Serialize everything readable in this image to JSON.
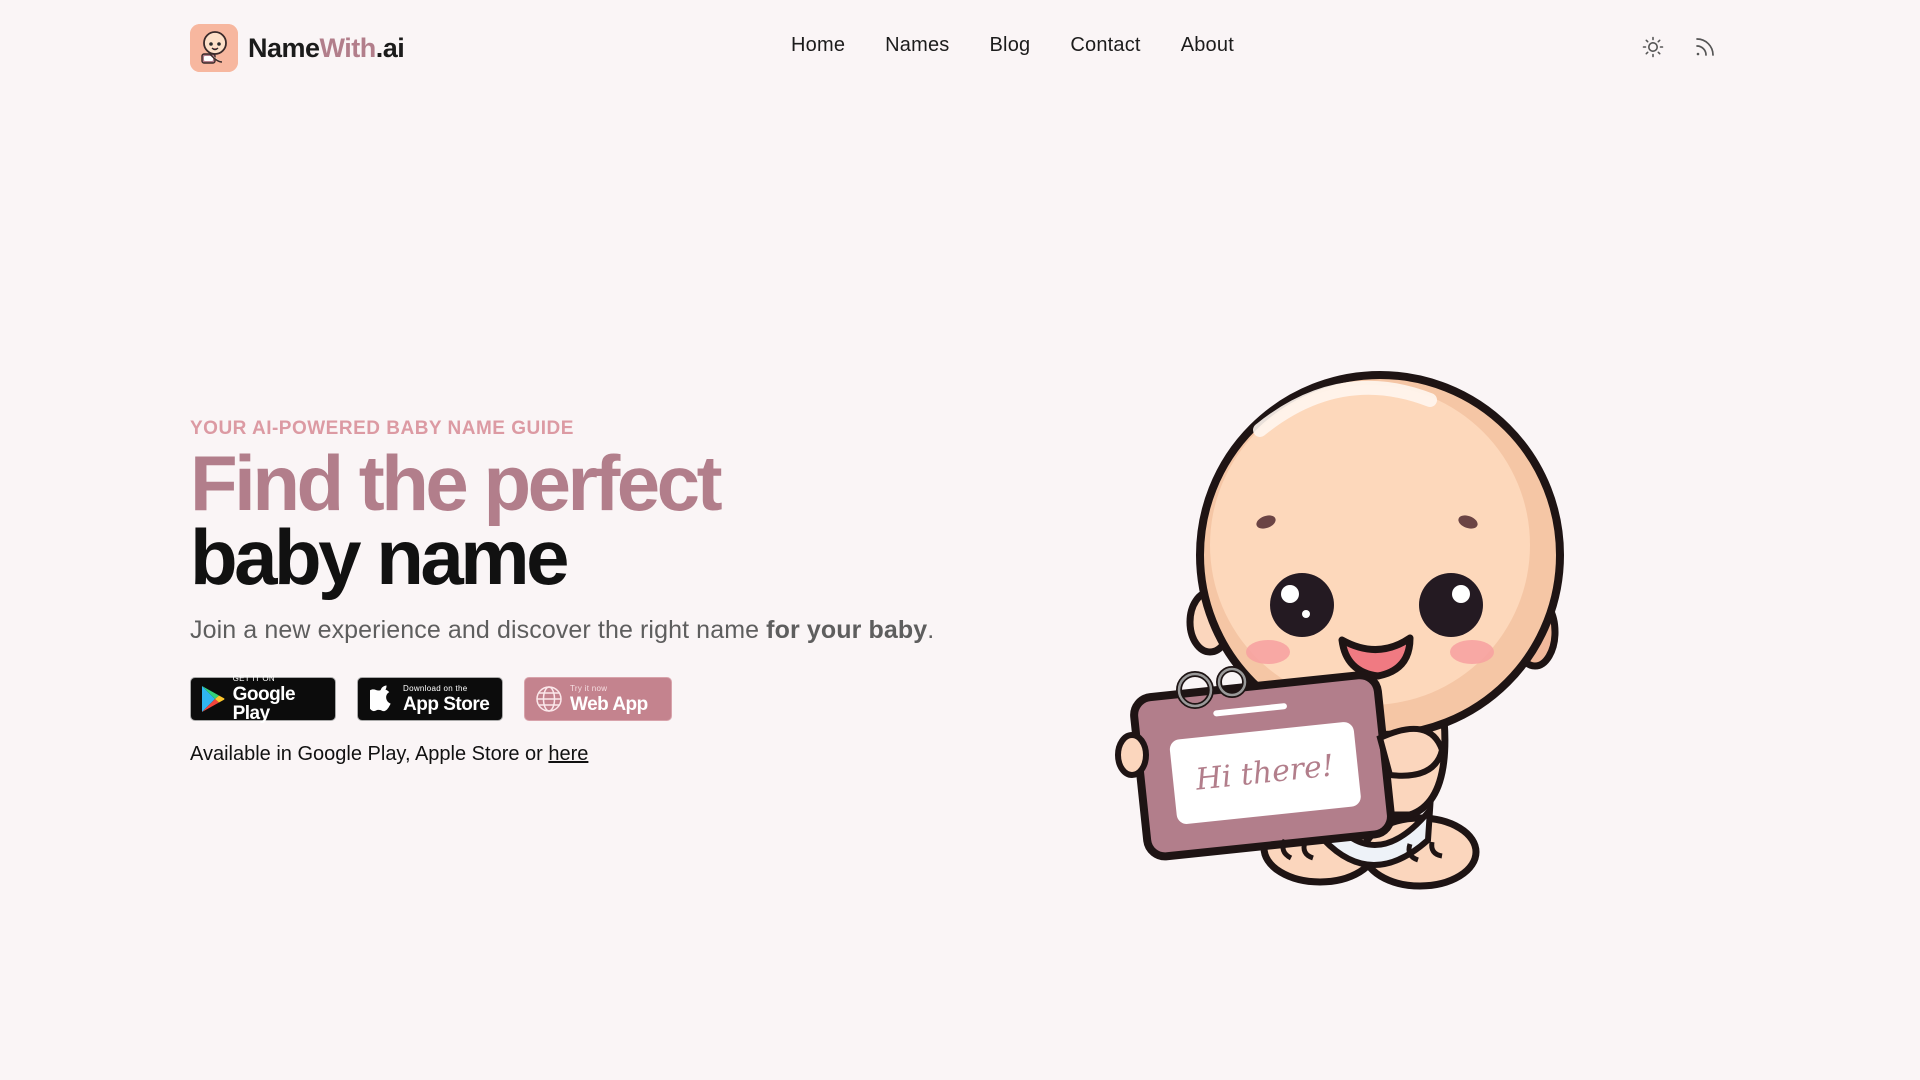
{
  "header": {
    "brand": {
      "part1": "Name",
      "part2": "With",
      "part3": ".ai"
    },
    "nav": [
      {
        "label": "Home"
      },
      {
        "label": "Names"
      },
      {
        "label": "Blog"
      },
      {
        "label": "Contact"
      },
      {
        "label": "About"
      }
    ],
    "icons": [
      "sun-icon",
      "rss-icon"
    ]
  },
  "hero": {
    "eyebrow": "YOUR AI-POWERED BABY NAME GUIDE",
    "headline_line1": "Find the perfect",
    "headline_line2": "baby name",
    "subtitle_prefix": "Join a new experience and discover the right name ",
    "subtitle_bold": "for your baby",
    "subtitle_suffix": ".",
    "stores": {
      "google": {
        "small": "GET IT ON",
        "big": "Google Play"
      },
      "apple": {
        "small": "Download on the",
        "big": "App Store"
      },
      "web": {
        "small": "Try it now",
        "big": "Web App"
      }
    },
    "availability_prefix": "Available in Google Play, Apple Store or ",
    "availability_link": "here"
  },
  "illustration": {
    "sign_text": "Hi there!"
  },
  "colors": {
    "accent": "#b27e8b",
    "eyebrow": "#dc9aa3",
    "background": "#faf5f6",
    "web_button": "#c4838e"
  }
}
